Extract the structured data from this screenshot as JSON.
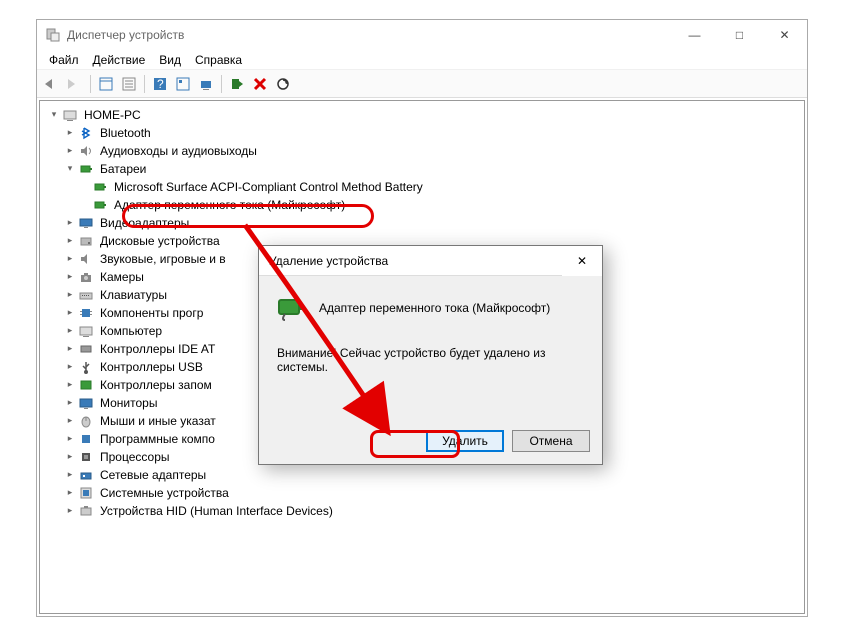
{
  "window": {
    "title": "Диспетчер устройств",
    "min": "—",
    "max": "□",
    "close": "✕"
  },
  "menu": {
    "file": "Файл",
    "action": "Действие",
    "view": "Вид",
    "help": "Справка"
  },
  "tree": {
    "root": "HOME-PC",
    "bluetooth": "Bluetooth",
    "audio": "Аудиовходы и аудиовыходы",
    "batteries": "Батареи",
    "bat1": "Microsoft Surface ACPI-Compliant Control Method Battery",
    "bat2": "Адаптер переменного тока (Майкрософт)",
    "video": "Видеоадаптеры",
    "disk": "Дисковые устройства",
    "sound": "Звуковые, игровые и в",
    "cameras": "Камеры",
    "keyboard": "Клавиатуры",
    "software": "Компоненты прогр",
    "computer": "Компьютер",
    "ide": "Контроллеры IDE AT",
    "usb": "Контроллеры USB",
    "storage": "Контроллеры запом",
    "monitors": "Мониторы",
    "mice": "Мыши и иные указат",
    "progcomp": "Программные компо",
    "cpu": "Процессоры",
    "net": "Сетевые адаптеры",
    "system": "Системные устройства",
    "hid": "Устройства HID (Human Interface Devices)"
  },
  "dialog": {
    "title": "Удаление устройства",
    "device": "Адаптер переменного тока (Майкрософт)",
    "warning": "Внимание! Сейчас устройство будет удалено из системы.",
    "ok": "Удалить",
    "cancel": "Отмена",
    "close": "✕"
  }
}
